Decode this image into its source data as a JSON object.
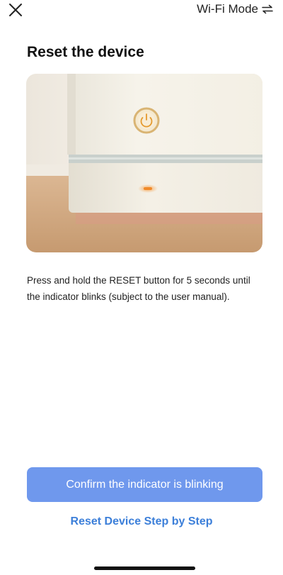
{
  "header": {
    "close_icon": "close-icon",
    "mode_label": "Wi-Fi Mode",
    "mode_icon": "swap-arrows-icon"
  },
  "main": {
    "title": "Reset the device",
    "image_subject": "white smart device with power button and orange indicator light",
    "instruction": "Press and hold the RESET button for 5 seconds until the indicator blinks (subject to the user manual)."
  },
  "actions": {
    "confirm_label": "Confirm the indicator is blinking",
    "step_link_label": "Reset Device Step by Step"
  },
  "colors": {
    "primary_button": "#6f98ed",
    "link": "#3c7fd9",
    "indicator_light": "#f08a2a"
  }
}
